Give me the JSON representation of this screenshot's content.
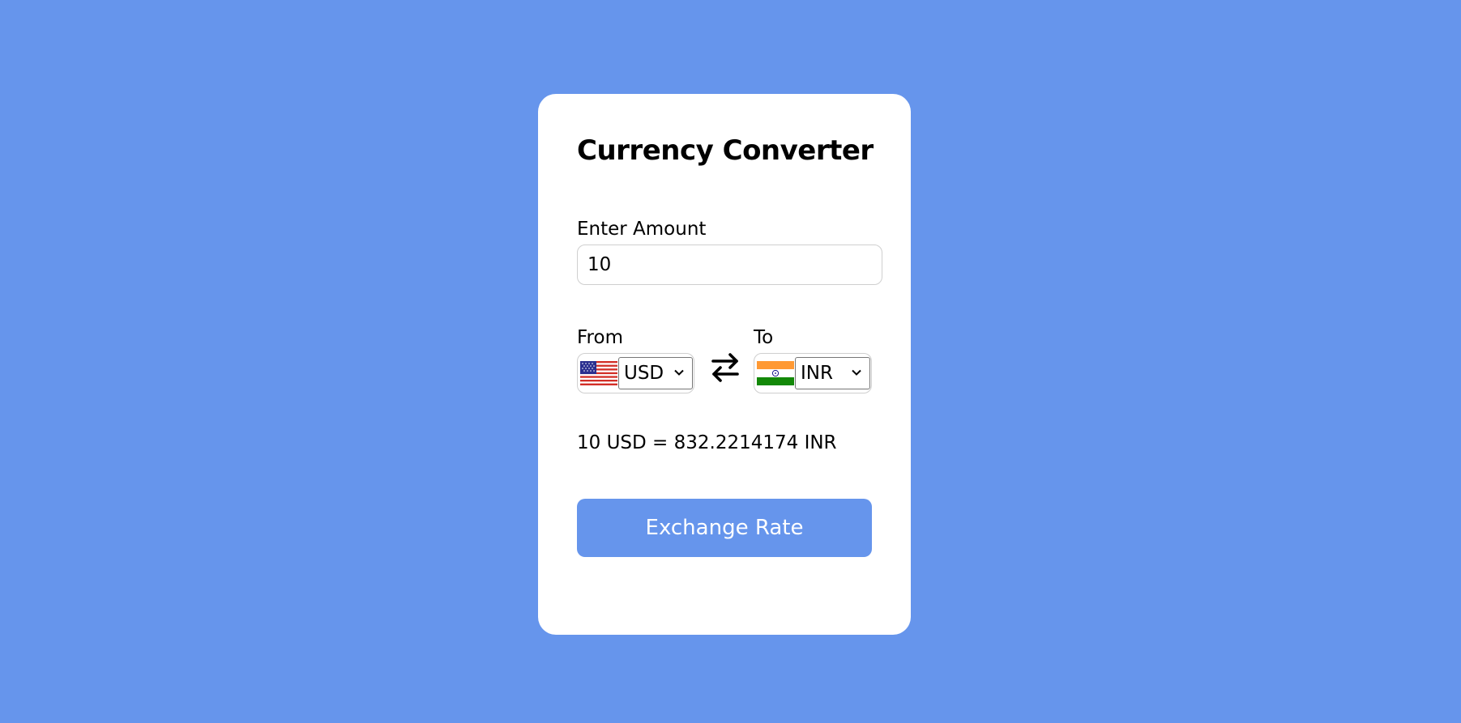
{
  "app": {
    "title": "Currency Converter",
    "background_color": "#6695ec",
    "accent_color": "#6695ec"
  },
  "amount": {
    "label": "Enter Amount",
    "value": "10"
  },
  "from": {
    "label": "From",
    "currency": "USD",
    "flag_icon": "us-flag-icon"
  },
  "to": {
    "label": "To",
    "currency": "INR",
    "flag_icon": "india-flag-icon"
  },
  "swap": {
    "icon": "swap-arrows-icon"
  },
  "result": {
    "text": "10 USD = 832.2214174 INR"
  },
  "exchange_button": {
    "label": "Exchange Rate"
  }
}
